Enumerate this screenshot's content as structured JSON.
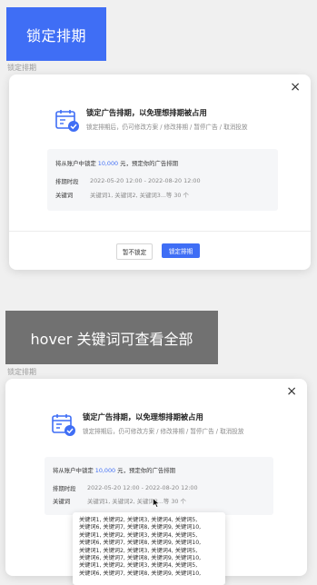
{
  "section1": {
    "tag": "锁定排期",
    "caption": "锁定排期",
    "modal": {
      "title": "锁定广告排期，以免理想排期被占用",
      "subtitle": "锁定排期后，仍可修改方案 / 修改排期 / 暂停广告 / 取消投放",
      "lead_prefix": "将从账户中锁定 ",
      "amount": "10,000",
      "lead_suffix": " 元，预定你的广告排期",
      "period_label": "排期时段",
      "period_value": "2022-05-20 12:00 - 2022-08-20 12:00",
      "keywords_label": "关键词",
      "keywords_value": "关键词1, 关键词2, 关键词3...等 30 个",
      "cancel_label": "暂不锁定",
      "confirm_label": "锁定排期",
      "close": "×"
    }
  },
  "section2": {
    "tag": "hover 关键词可查看全部",
    "caption": "锁定排期",
    "modal": {
      "title": "锁定广告排期，以免理想排期被占用",
      "subtitle": "锁定排期后，仍可修改方案 / 修改排期 / 暂停广告 / 取消投放",
      "lead_prefix": "将从账户中锁定 ",
      "amount": "10,000",
      "lead_suffix": " 元，预定你的广告排期",
      "period_label": "排期时段",
      "period_value": "2022-05-20 12:00 - 2022-08-20 12:00",
      "keywords_label": "关键词",
      "keywords_value": "关键词1, 关键词2, 关键词3...等 30 个",
      "close": "×"
    },
    "tooltip_lines": [
      "关键词1, 关键词2, 关键词3, 关键词4, 关键词5,",
      "关键词6, 关键词7, 关键词8, 关键词9, 关键词10,",
      "关键词1, 关键词2, 关键词3, 关键词4, 关键词5,",
      "关键词6, 关键词7, 关键词8, 关键词9, 关键词10,",
      "关键词1, 关键词2, 关键词3, 关键词4, 关键词5,",
      "关键词6, 关键词7, 关键词8, 关键词9, 关键词10,",
      "关键词1, 关键词2, 关键词3, 关键词4, 关键词5,",
      "关键词6, 关键词7, 关键词8, 关键词9, 关键词10,"
    ]
  },
  "colors": {
    "accent": "#3f6ef5",
    "dark_tag": "#717171"
  },
  "icons": {
    "calendar": "calendar-check-icon",
    "close": "close-icon",
    "cursor": "mouse-pointer-icon"
  }
}
